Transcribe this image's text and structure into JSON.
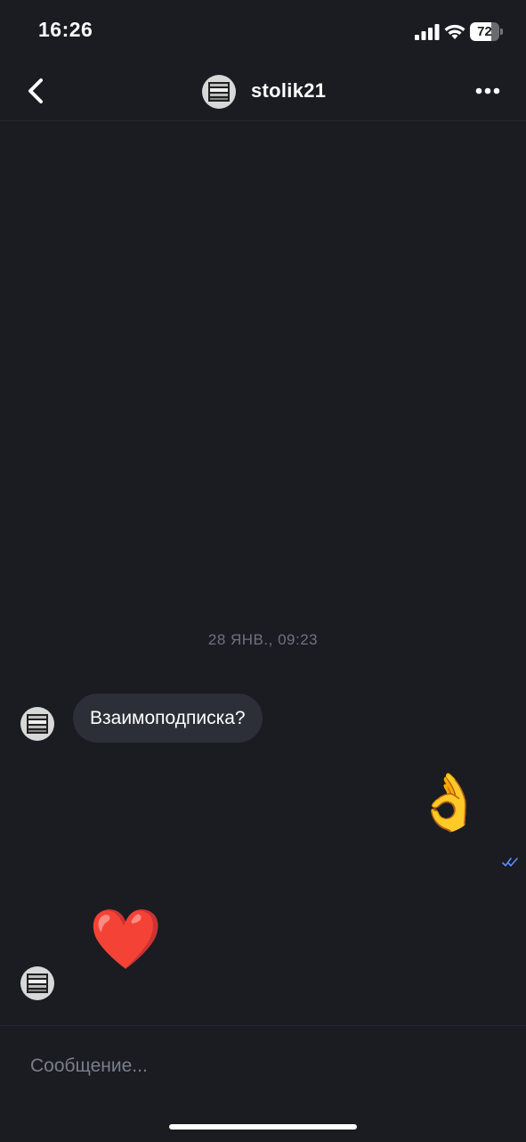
{
  "status_bar": {
    "time": "16:26",
    "battery_percent": "72",
    "battery_level": 0.72
  },
  "header": {
    "title": "stolik21",
    "back_icon": "chevron-left-icon",
    "more_icon": "ellipsis-icon"
  },
  "chat": {
    "date_separator": "28 ЯНВ., 09:23",
    "messages": [
      {
        "sender": "them",
        "type": "text",
        "text": "Взаимоподписка?"
      },
      {
        "sender": "me",
        "type": "emoji",
        "text": "👌",
        "status": "read"
      },
      {
        "sender": "them",
        "type": "emoji",
        "text": "❤️"
      }
    ],
    "read_status_color": "#5b8cff"
  },
  "composer": {
    "placeholder": "Сообщение..."
  },
  "colors": {
    "background": "#1a1c22",
    "bubble": "#2c2f37",
    "muted_text": "#6e7280"
  }
}
